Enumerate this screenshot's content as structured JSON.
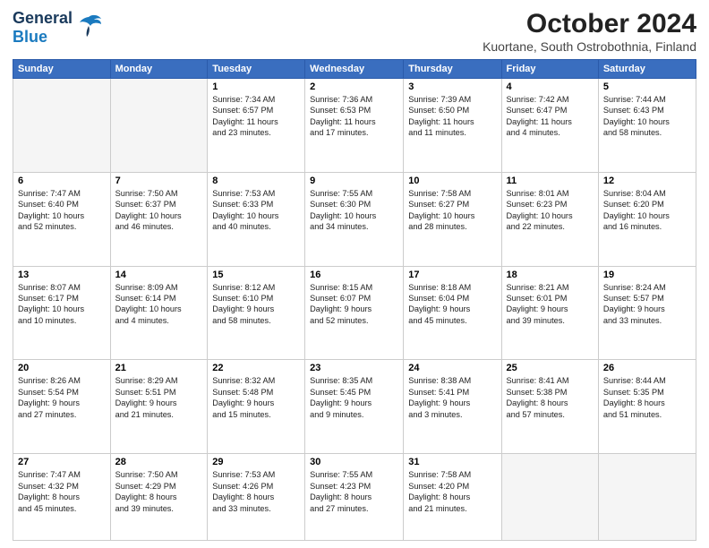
{
  "header": {
    "logo_line1": "General",
    "logo_line2": "Blue",
    "title": "October 2024",
    "subtitle": "Kuortane, South Ostrobothnia, Finland"
  },
  "days_of_week": [
    "Sunday",
    "Monday",
    "Tuesday",
    "Wednesday",
    "Thursday",
    "Friday",
    "Saturday"
  ],
  "weeks": [
    [
      {
        "day": "",
        "info": ""
      },
      {
        "day": "",
        "info": ""
      },
      {
        "day": "1",
        "info": "Sunrise: 7:34 AM\nSunset: 6:57 PM\nDaylight: 11 hours\nand 23 minutes."
      },
      {
        "day": "2",
        "info": "Sunrise: 7:36 AM\nSunset: 6:53 PM\nDaylight: 11 hours\nand 17 minutes."
      },
      {
        "day": "3",
        "info": "Sunrise: 7:39 AM\nSunset: 6:50 PM\nDaylight: 11 hours\nand 11 minutes."
      },
      {
        "day": "4",
        "info": "Sunrise: 7:42 AM\nSunset: 6:47 PM\nDaylight: 11 hours\nand 4 minutes."
      },
      {
        "day": "5",
        "info": "Sunrise: 7:44 AM\nSunset: 6:43 PM\nDaylight: 10 hours\nand 58 minutes."
      }
    ],
    [
      {
        "day": "6",
        "info": "Sunrise: 7:47 AM\nSunset: 6:40 PM\nDaylight: 10 hours\nand 52 minutes."
      },
      {
        "day": "7",
        "info": "Sunrise: 7:50 AM\nSunset: 6:37 PM\nDaylight: 10 hours\nand 46 minutes."
      },
      {
        "day": "8",
        "info": "Sunrise: 7:53 AM\nSunset: 6:33 PM\nDaylight: 10 hours\nand 40 minutes."
      },
      {
        "day": "9",
        "info": "Sunrise: 7:55 AM\nSunset: 6:30 PM\nDaylight: 10 hours\nand 34 minutes."
      },
      {
        "day": "10",
        "info": "Sunrise: 7:58 AM\nSunset: 6:27 PM\nDaylight: 10 hours\nand 28 minutes."
      },
      {
        "day": "11",
        "info": "Sunrise: 8:01 AM\nSunset: 6:23 PM\nDaylight: 10 hours\nand 22 minutes."
      },
      {
        "day": "12",
        "info": "Sunrise: 8:04 AM\nSunset: 6:20 PM\nDaylight: 10 hours\nand 16 minutes."
      }
    ],
    [
      {
        "day": "13",
        "info": "Sunrise: 8:07 AM\nSunset: 6:17 PM\nDaylight: 10 hours\nand 10 minutes."
      },
      {
        "day": "14",
        "info": "Sunrise: 8:09 AM\nSunset: 6:14 PM\nDaylight: 10 hours\nand 4 minutes."
      },
      {
        "day": "15",
        "info": "Sunrise: 8:12 AM\nSunset: 6:10 PM\nDaylight: 9 hours\nand 58 minutes."
      },
      {
        "day": "16",
        "info": "Sunrise: 8:15 AM\nSunset: 6:07 PM\nDaylight: 9 hours\nand 52 minutes."
      },
      {
        "day": "17",
        "info": "Sunrise: 8:18 AM\nSunset: 6:04 PM\nDaylight: 9 hours\nand 45 minutes."
      },
      {
        "day": "18",
        "info": "Sunrise: 8:21 AM\nSunset: 6:01 PM\nDaylight: 9 hours\nand 39 minutes."
      },
      {
        "day": "19",
        "info": "Sunrise: 8:24 AM\nSunset: 5:57 PM\nDaylight: 9 hours\nand 33 minutes."
      }
    ],
    [
      {
        "day": "20",
        "info": "Sunrise: 8:26 AM\nSunset: 5:54 PM\nDaylight: 9 hours\nand 27 minutes."
      },
      {
        "day": "21",
        "info": "Sunrise: 8:29 AM\nSunset: 5:51 PM\nDaylight: 9 hours\nand 21 minutes."
      },
      {
        "day": "22",
        "info": "Sunrise: 8:32 AM\nSunset: 5:48 PM\nDaylight: 9 hours\nand 15 minutes."
      },
      {
        "day": "23",
        "info": "Sunrise: 8:35 AM\nSunset: 5:45 PM\nDaylight: 9 hours\nand 9 minutes."
      },
      {
        "day": "24",
        "info": "Sunrise: 8:38 AM\nSunset: 5:41 PM\nDaylight: 9 hours\nand 3 minutes."
      },
      {
        "day": "25",
        "info": "Sunrise: 8:41 AM\nSunset: 5:38 PM\nDaylight: 8 hours\nand 57 minutes."
      },
      {
        "day": "26",
        "info": "Sunrise: 8:44 AM\nSunset: 5:35 PM\nDaylight: 8 hours\nand 51 minutes."
      }
    ],
    [
      {
        "day": "27",
        "info": "Sunrise: 7:47 AM\nSunset: 4:32 PM\nDaylight: 8 hours\nand 45 minutes."
      },
      {
        "day": "28",
        "info": "Sunrise: 7:50 AM\nSunset: 4:29 PM\nDaylight: 8 hours\nand 39 minutes."
      },
      {
        "day": "29",
        "info": "Sunrise: 7:53 AM\nSunset: 4:26 PM\nDaylight: 8 hours\nand 33 minutes."
      },
      {
        "day": "30",
        "info": "Sunrise: 7:55 AM\nSunset: 4:23 PM\nDaylight: 8 hours\nand 27 minutes."
      },
      {
        "day": "31",
        "info": "Sunrise: 7:58 AM\nSunset: 4:20 PM\nDaylight: 8 hours\nand 21 minutes."
      },
      {
        "day": "",
        "info": ""
      },
      {
        "day": "",
        "info": ""
      }
    ]
  ]
}
